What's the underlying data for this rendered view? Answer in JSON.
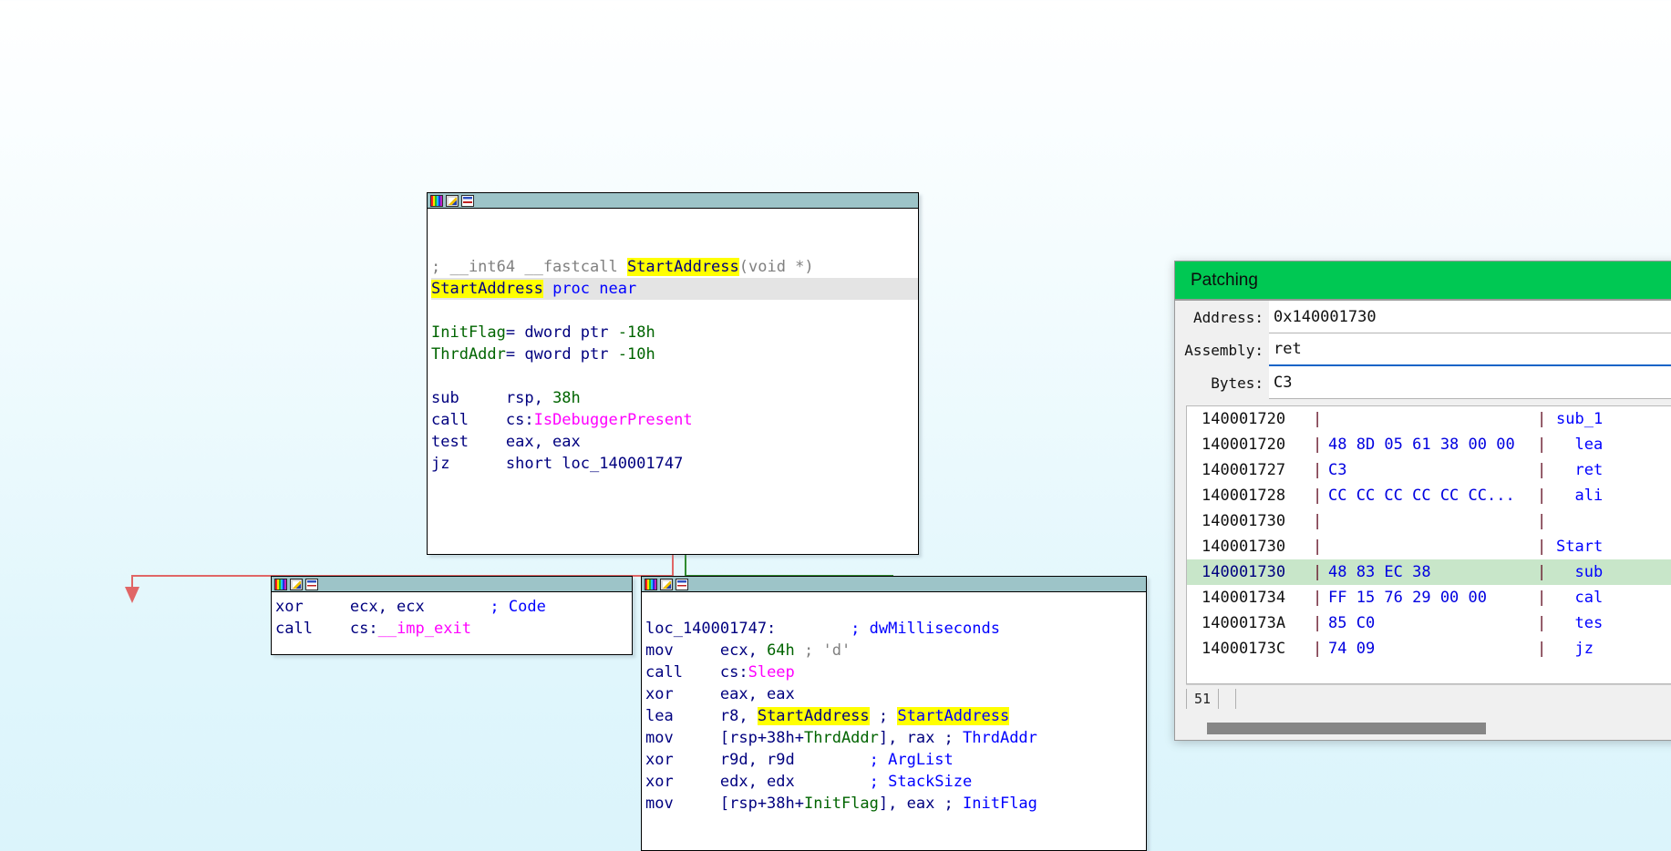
{
  "graph": {
    "nodes": [
      {
        "name": "entry-block",
        "titlebar_icons": [
          "colors-icon",
          "pencil-icon",
          "chart-icon"
        ],
        "lines": [
          {
            "segments": [
              {
                "t": "",
                "c": "kw"
              }
            ]
          },
          {
            "segments": [
              {
                "t": "",
                "c": "kw"
              }
            ]
          },
          {
            "segments": [
              {
                "t": "; __int64 __fastcall ",
                "c": "cmt"
              },
              {
                "t": "StartAddress",
                "c": "hl"
              },
              {
                "t": "(void *)",
                "c": "cmt"
              }
            ]
          },
          {
            "row": "proc",
            "segments": [
              {
                "t": "StartAddress",
                "c": "hl"
              },
              {
                "t": " ",
                "c": "kw"
              },
              {
                "t": "proc near",
                "c": "blue"
              }
            ]
          },
          {
            "segments": [
              {
                "t": "",
                "c": "kw"
              }
            ]
          },
          {
            "segments": [
              {
                "t": "InitFlag",
                "c": "grn"
              },
              {
                "t": "= ",
                "c": "kw"
              },
              {
                "t": "dword ptr ",
                "c": "kw"
              },
              {
                "t": "-18h",
                "c": "grn"
              }
            ]
          },
          {
            "segments": [
              {
                "t": "ThrdAddr",
                "c": "grn"
              },
              {
                "t": "= ",
                "c": "kw"
              },
              {
                "t": "qword ptr ",
                "c": "kw"
              },
              {
                "t": "-10h",
                "c": "grn"
              }
            ]
          },
          {
            "segments": [
              {
                "t": "",
                "c": "kw"
              }
            ]
          },
          {
            "segments": [
              {
                "t": "sub     rsp, ",
                "c": "kw"
              },
              {
                "t": "38h",
                "c": "grn"
              }
            ]
          },
          {
            "segments": [
              {
                "t": "call    cs:",
                "c": "kw"
              },
              {
                "t": "IsDebuggerPresent",
                "c": "mag"
              }
            ]
          },
          {
            "segments": [
              {
                "t": "test    eax, eax",
                "c": "kw"
              }
            ]
          },
          {
            "segments": [
              {
                "t": "jz      short loc_140001747",
                "c": "kw"
              }
            ]
          }
        ]
      },
      {
        "name": "exit-block",
        "titlebar_icons": [
          "colors-icon",
          "pencil-icon",
          "chart-icon"
        ],
        "lines": [
          {
            "segments": [
              {
                "t": "xor     ecx, ecx       ",
                "c": "kw"
              },
              {
                "t": "; Code",
                "c": "blue"
              }
            ]
          },
          {
            "segments": [
              {
                "t": "call    cs:",
                "c": "kw"
              },
              {
                "t": "__imp_exit",
                "c": "mag"
              }
            ]
          }
        ]
      },
      {
        "name": "loop-block",
        "titlebar_icons": [
          "colors-icon",
          "pencil-icon",
          "chart-icon"
        ],
        "lines": [
          {
            "segments": [
              {
                "t": "",
                "c": "kw"
              }
            ]
          },
          {
            "segments": [
              {
                "t": "loc_140001747:        ",
                "c": "kw"
              },
              {
                "t": "; dwMilliseconds",
                "c": "blue"
              }
            ]
          },
          {
            "segments": [
              {
                "t": "mov     ecx, ",
                "c": "kw"
              },
              {
                "t": "64h",
                "c": "grn"
              },
              {
                "t": " ; 'd'",
                "c": "cmt"
              }
            ]
          },
          {
            "segments": [
              {
                "t": "call    cs:",
                "c": "kw"
              },
              {
                "t": "Sleep",
                "c": "mag"
              }
            ]
          },
          {
            "segments": [
              {
                "t": "xor     eax, eax",
                "c": "kw"
              }
            ]
          },
          {
            "segments": [
              {
                "t": "lea     r8, ",
                "c": "kw"
              },
              {
                "t": "StartAddress",
                "c": "hl"
              },
              {
                "t": " ; ",
                "c": "kw"
              },
              {
                "t": "StartAddress",
                "c": "hlblue"
              }
            ]
          },
          {
            "segments": [
              {
                "t": "mov     [rsp+38h+",
                "c": "kw"
              },
              {
                "t": "ThrdAddr",
                "c": "grn"
              },
              {
                "t": "], rax ; ",
                "c": "kw"
              },
              {
                "t": "ThrdAddr",
                "c": "blue"
              }
            ]
          },
          {
            "segments": [
              {
                "t": "xor     r9d, r9d        ",
                "c": "kw"
              },
              {
                "t": "; ArgList",
                "c": "blue"
              }
            ]
          },
          {
            "segments": [
              {
                "t": "xor     edx, edx        ",
                "c": "kw"
              },
              {
                "t": "; StackSize",
                "c": "blue"
              }
            ]
          },
          {
            "segments": [
              {
                "t": "mov     [rsp+38h+",
                "c": "kw"
              },
              {
                "t": "InitFlag",
                "c": "grn"
              },
              {
                "t": "], eax ; ",
                "c": "kw"
              },
              {
                "t": "InitFlag",
                "c": "blue"
              }
            ]
          }
        ]
      }
    ],
    "edge_colors": {
      "false_branch": "#e06666",
      "true_branch": "#2e8b2e"
    }
  },
  "patching": {
    "title": "Patching",
    "title_bg": "#00c853",
    "address_label": "Address:",
    "address_value": "0x140001730",
    "assembly_label": "Assembly:",
    "assembly_value": "ret",
    "bytes_label": "Bytes:",
    "bytes_value": "C3",
    "rows": [
      {
        "addr": "140001720",
        "bytes": "",
        "disasm": "sub_1"
      },
      {
        "addr": "140001720",
        "bytes": "48 8D 05 61 38 00 00",
        "disasm": "  lea"
      },
      {
        "addr": "140001727",
        "bytes": "C3",
        "disasm": "  ret"
      },
      {
        "addr": "140001728",
        "bytes": "CC CC CC CC CC CC...",
        "disasm": "  ali"
      },
      {
        "addr": "140001730",
        "bytes": "",
        "disasm": ""
      },
      {
        "addr": "140001730",
        "bytes": "",
        "disasm": "Start"
      },
      {
        "addr": "140001730",
        "bytes": "48 83 EC 38",
        "disasm": "  sub",
        "selected": true
      },
      {
        "addr": "140001734",
        "bytes": "FF 15 76 29 00 00",
        "disasm": "  cal"
      },
      {
        "addr": "14000173A",
        "bytes": "85 C0",
        "disasm": "  tes"
      },
      {
        "addr": "14000173C",
        "bytes": "74 09",
        "disasm": "  jz"
      }
    ],
    "status_count": "51",
    "selected_row_bg": "#c8e6c9"
  }
}
